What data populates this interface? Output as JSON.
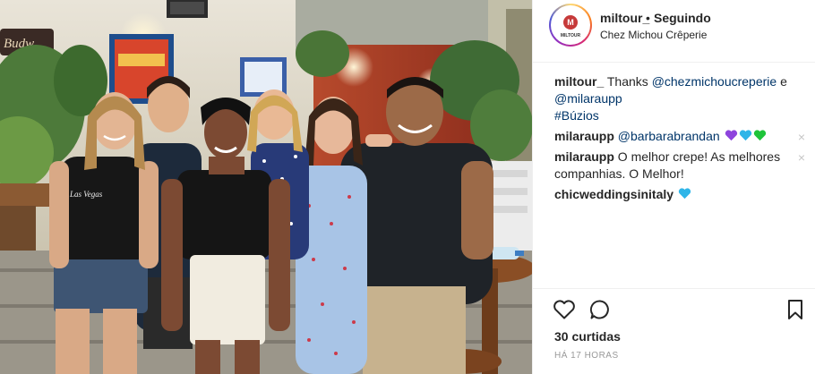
{
  "header": {
    "username": "miltour_",
    "separator": "•",
    "follow_status": "Seguindo",
    "location": "Chez Michou Crêperie",
    "avatar_text": "MILTOUR"
  },
  "photo": {
    "sign_text": "Budw",
    "shirt_text": "Las Vegas"
  },
  "comments": [
    {
      "user": "miltour_",
      "text_1": "Thanks",
      "mention_1": "@chezmichoucreperie",
      "text_2": "e",
      "mention_2": "@milaraupp",
      "hashtag": "#Búzios"
    },
    {
      "user": "milaraupp",
      "mention": "@barbarabrandan",
      "hearts": [
        "purple-heart",
        "blue-heart",
        "green-heart"
      ],
      "close": "×"
    },
    {
      "user": "milaraupp",
      "text": "O melhor crepe! As melhores companhias. O Melhor!",
      "close": "×"
    },
    {
      "user": "chicweddingsinitaly",
      "hearts": [
        "blue-heart"
      ]
    }
  ],
  "actions": {
    "likes": "30 curtidas",
    "time": "HÁ 17 HORAS"
  },
  "colors": {
    "link": "#003569",
    "purple_heart": "#8e44dd",
    "blue_heart": "#2fb5e8",
    "green_heart": "#1fc43a"
  }
}
